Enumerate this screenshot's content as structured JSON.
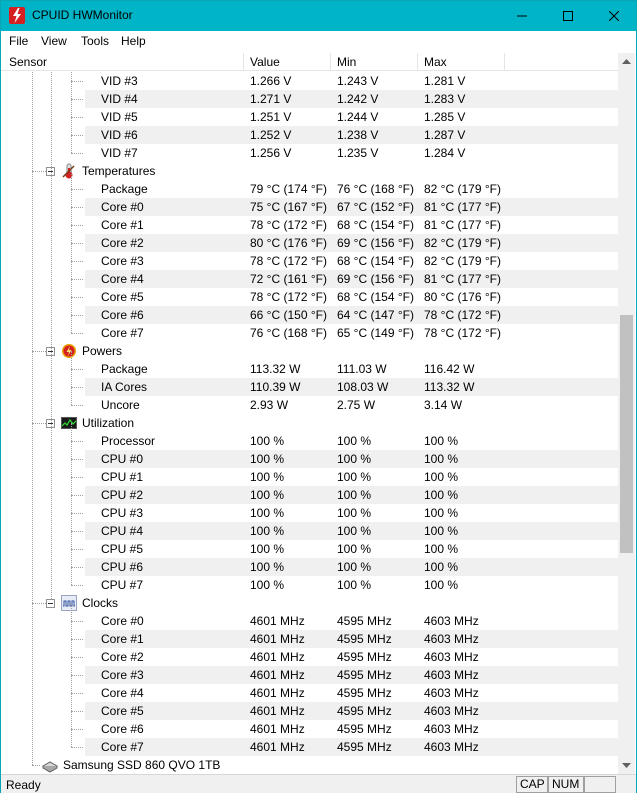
{
  "window": {
    "title": "CPUID HWMonitor"
  },
  "menu": [
    "File",
    "View",
    "Tools",
    "Help"
  ],
  "columns": {
    "sensor": "Sensor",
    "value": "Value",
    "min": "Min",
    "max": "Max"
  },
  "vid": [
    {
      "name": "VID #3",
      "value": "1.266 V",
      "min": "1.243 V",
      "max": "1.281 V"
    },
    {
      "name": "VID #4",
      "value": "1.271 V",
      "min": "1.242 V",
      "max": "1.283 V"
    },
    {
      "name": "VID #5",
      "value": "1.251 V",
      "min": "1.244 V",
      "max": "1.285 V"
    },
    {
      "name": "VID #6",
      "value": "1.252 V",
      "min": "1.238 V",
      "max": "1.287 V"
    },
    {
      "name": "VID #7",
      "value": "1.256 V",
      "min": "1.235 V",
      "max": "1.284 V"
    }
  ],
  "temperatures": {
    "label": "Temperatures",
    "rows": [
      {
        "name": "Package",
        "value": "79 °C  (174 °F)",
        "min": "76 °C  (168 °F)",
        "max": "82 °C  (179 °F)"
      },
      {
        "name": "Core #0",
        "value": "75 °C  (167 °F)",
        "min": "67 °C  (152 °F)",
        "max": "81 °C  (177 °F)"
      },
      {
        "name": "Core #1",
        "value": "78 °C  (172 °F)",
        "min": "68 °C  (154 °F)",
        "max": "81 °C  (177 °F)"
      },
      {
        "name": "Core #2",
        "value": "80 °C  (176 °F)",
        "min": "69 °C  (156 °F)",
        "max": "82 °C  (179 °F)"
      },
      {
        "name": "Core #3",
        "value": "78 °C  (172 °F)",
        "min": "68 °C  (154 °F)",
        "max": "82 °C  (179 °F)"
      },
      {
        "name": "Core #4",
        "value": "72 °C  (161 °F)",
        "min": "69 °C  (156 °F)",
        "max": "81 °C  (177 °F)"
      },
      {
        "name": "Core #5",
        "value": "78 °C  (172 °F)",
        "min": "68 °C  (154 °F)",
        "max": "80 °C  (176 °F)"
      },
      {
        "name": "Core #6",
        "value": "66 °C  (150 °F)",
        "min": "64 °C  (147 °F)",
        "max": "78 °C  (172 °F)"
      },
      {
        "name": "Core #7",
        "value": "76 °C  (168 °F)",
        "min": "65 °C  (149 °F)",
        "max": "78 °C  (172 °F)"
      }
    ]
  },
  "powers": {
    "label": "Powers",
    "rows": [
      {
        "name": "Package",
        "value": "113.32 W",
        "min": "111.03 W",
        "max": "116.42 W"
      },
      {
        "name": "IA Cores",
        "value": "110.39 W",
        "min": "108.03 W",
        "max": "113.32 W"
      },
      {
        "name": "Uncore",
        "value": "2.93 W",
        "min": "2.75 W",
        "max": "3.14 W"
      }
    ]
  },
  "utilization": {
    "label": "Utilization",
    "rows": [
      {
        "name": "Processor",
        "value": "100 %",
        "min": "100 %",
        "max": "100 %"
      },
      {
        "name": "CPU #0",
        "value": "100 %",
        "min": "100 %",
        "max": "100 %"
      },
      {
        "name": "CPU #1",
        "value": "100 %",
        "min": "100 %",
        "max": "100 %"
      },
      {
        "name": "CPU #2",
        "value": "100 %",
        "min": "100 %",
        "max": "100 %"
      },
      {
        "name": "CPU #3",
        "value": "100 %",
        "min": "100 %",
        "max": "100 %"
      },
      {
        "name": "CPU #4",
        "value": "100 %",
        "min": "100 %",
        "max": "100 %"
      },
      {
        "name": "CPU #5",
        "value": "100 %",
        "min": "100 %",
        "max": "100 %"
      },
      {
        "name": "CPU #6",
        "value": "100 %",
        "min": "100 %",
        "max": "100 %"
      },
      {
        "name": "CPU #7",
        "value": "100 %",
        "min": "100 %",
        "max": "100 %"
      }
    ]
  },
  "clocks": {
    "label": "Clocks",
    "rows": [
      {
        "name": "Core #0",
        "value": "4601 MHz",
        "min": "4595 MHz",
        "max": "4603 MHz"
      },
      {
        "name": "Core #1",
        "value": "4601 MHz",
        "min": "4595 MHz",
        "max": "4603 MHz"
      },
      {
        "name": "Core #2",
        "value": "4601 MHz",
        "min": "4595 MHz",
        "max": "4603 MHz"
      },
      {
        "name": "Core #3",
        "value": "4601 MHz",
        "min": "4595 MHz",
        "max": "4603 MHz"
      },
      {
        "name": "Core #4",
        "value": "4601 MHz",
        "min": "4595 MHz",
        "max": "4603 MHz"
      },
      {
        "name": "Core #5",
        "value": "4601 MHz",
        "min": "4595 MHz",
        "max": "4603 MHz"
      },
      {
        "name": "Core #6",
        "value": "4601 MHz",
        "min": "4595 MHz",
        "max": "4603 MHz"
      },
      {
        "name": "Core #7",
        "value": "4601 MHz",
        "min": "4595 MHz",
        "max": "4603 MHz"
      }
    ]
  },
  "device": {
    "label": "Samsung SSD 860 QVO 1TB"
  },
  "status": {
    "text": "Ready",
    "cap": "CAP",
    "num": "NUM"
  },
  "colors": {
    "titlebar": "#00b4c8",
    "stripe": "#f0f0f0",
    "app_icon": "#d42020"
  }
}
